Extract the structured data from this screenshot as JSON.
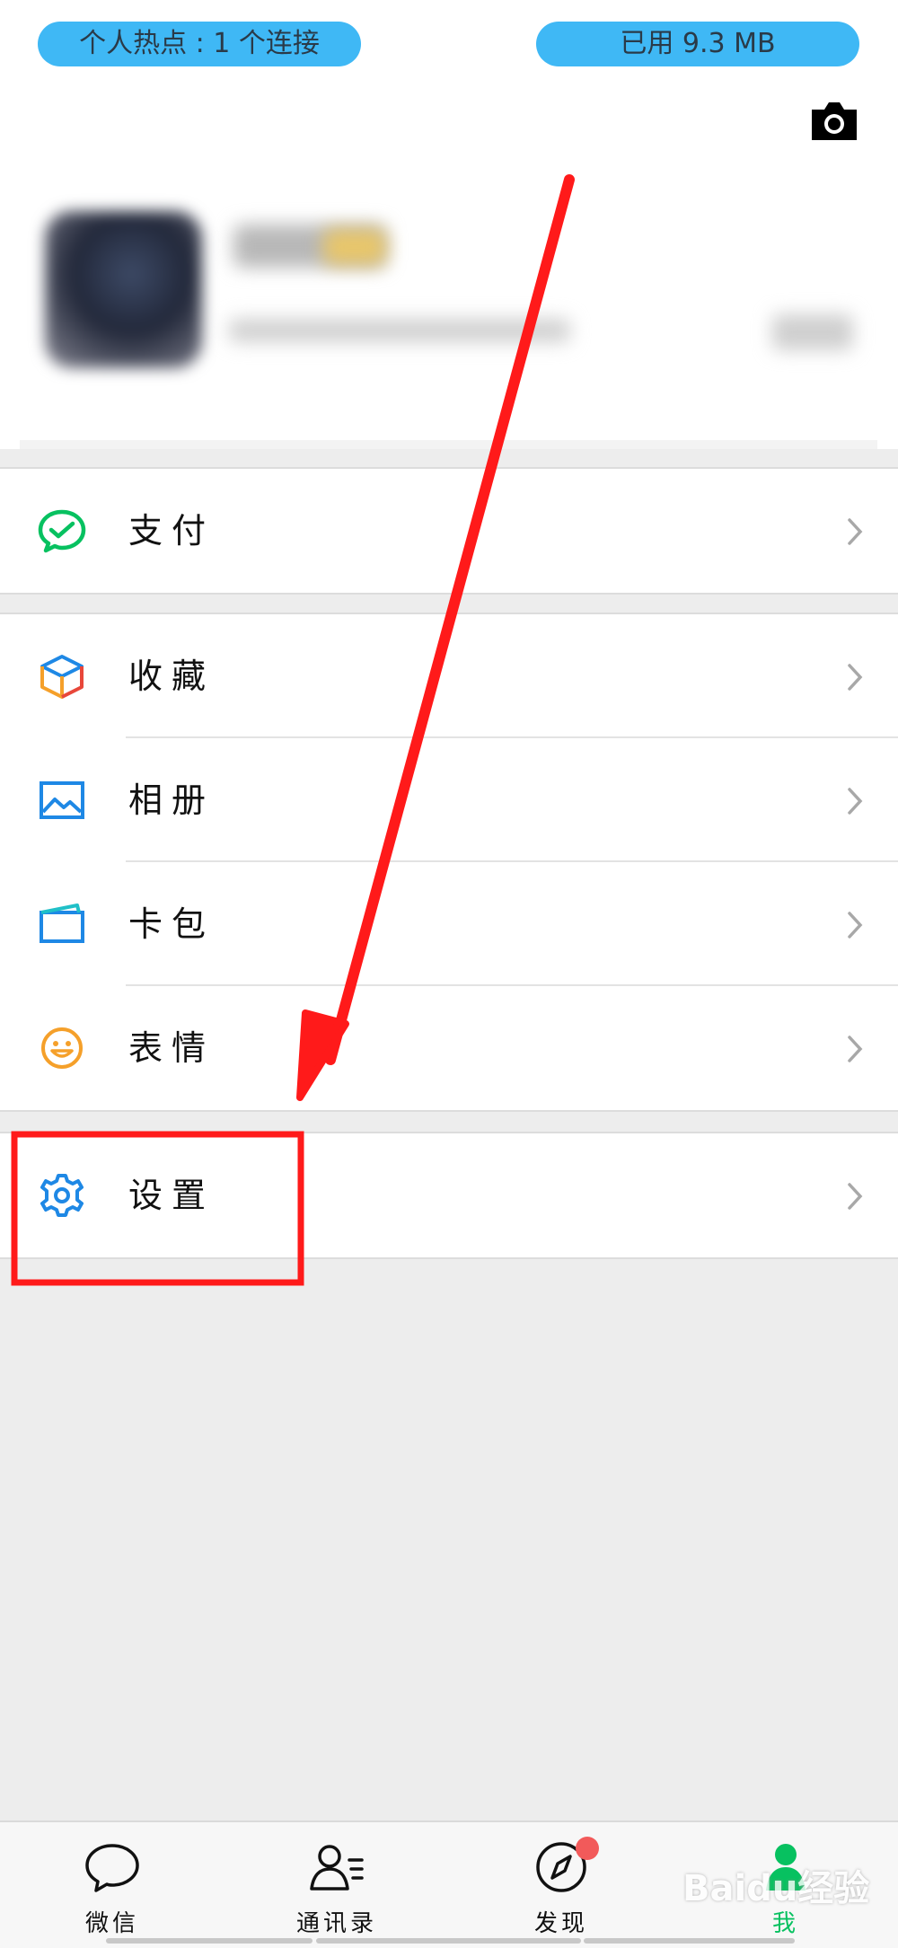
{
  "status": {
    "hotspot": "个人热点 : 1 个连接",
    "data_used": "已用 9.3 MB"
  },
  "menu": {
    "pay": "支付",
    "favorites": "收藏",
    "album": "相册",
    "cards": "卡包",
    "stickers": "表情",
    "settings": "设置"
  },
  "tabs": {
    "chats": "微信",
    "contacts": "通讯录",
    "discover": "发现",
    "me": "我"
  },
  "watermark": "Baidu经验",
  "colors": {
    "wechat_green": "#07c160",
    "icon_blue": "#1e88e5",
    "sticker_orange": "#f5a02a",
    "status_pill": "#3fb8f5",
    "annotation_red": "#ff1a1a",
    "badge_red": "#f25a5a"
  },
  "icons": {
    "camera": "camera-icon",
    "pay": "wechat-pay-icon",
    "favorites": "cube-icon",
    "album": "picture-icon",
    "cards": "wallet-icon",
    "stickers": "smile-icon",
    "settings": "gear-icon"
  }
}
